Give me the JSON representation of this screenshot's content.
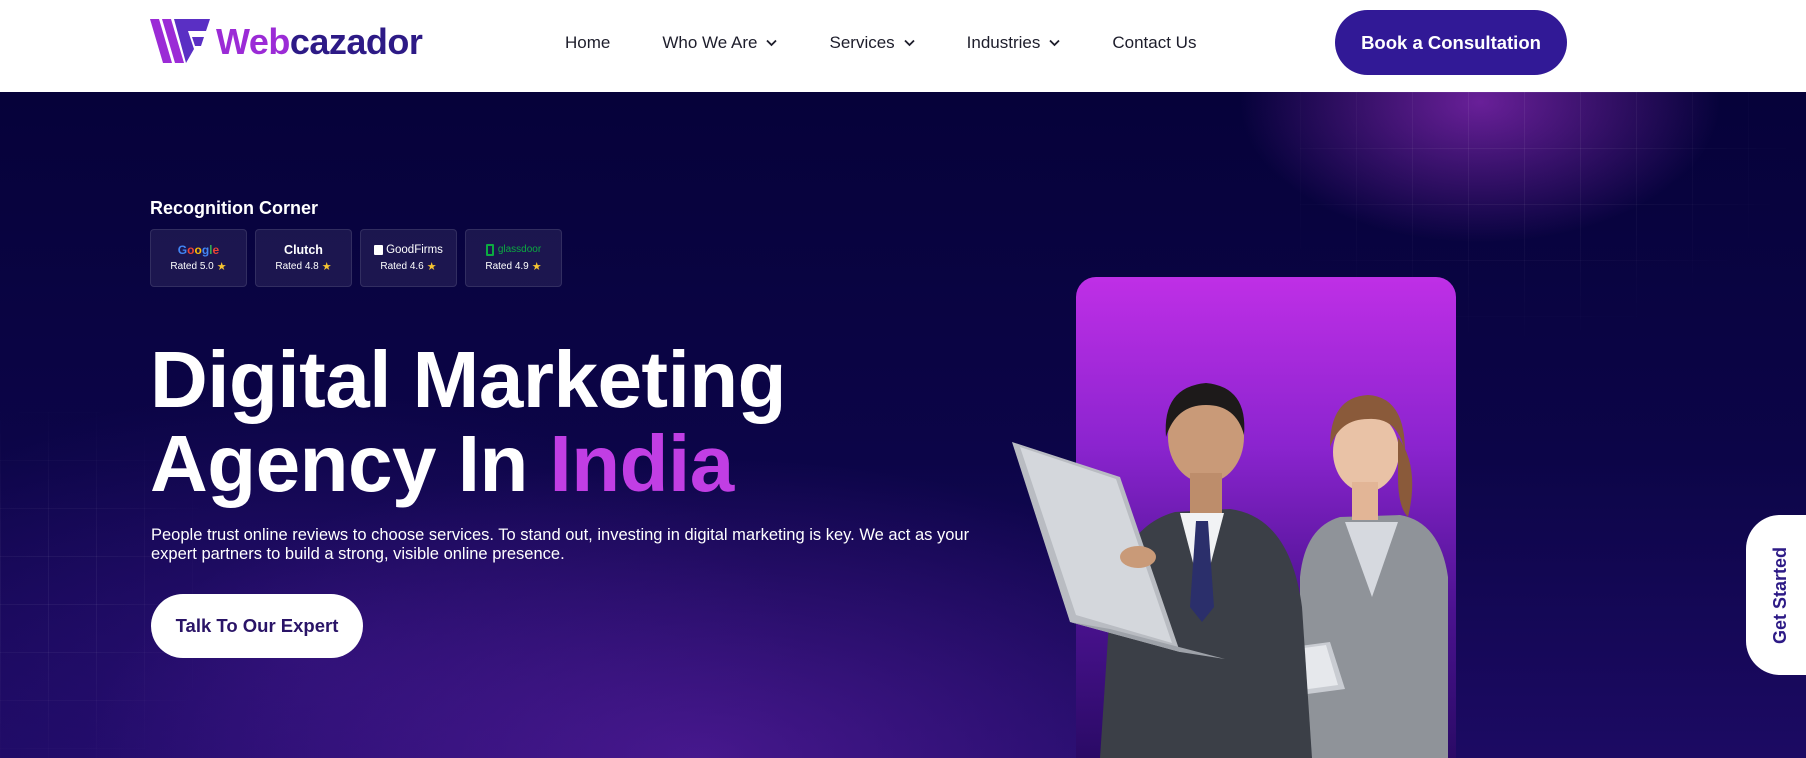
{
  "brand": {
    "logo_part1": "Web",
    "logo_part2": "cazador",
    "colors": {
      "primary": "#311996",
      "accent": "#c13ee4",
      "logo_purple": "#9b2bd6",
      "logo_navy": "#2d1a86"
    }
  },
  "nav": {
    "items": [
      {
        "label": "Home",
        "has_dropdown": false
      },
      {
        "label": "Who We Are",
        "has_dropdown": true
      },
      {
        "label": "Services",
        "has_dropdown": true
      },
      {
        "label": "Industries",
        "has_dropdown": true
      },
      {
        "label": "Contact Us",
        "has_dropdown": false
      }
    ],
    "cta": "Book a Consultation"
  },
  "hero": {
    "recognition_title": "Recognition Corner",
    "badges": [
      {
        "brand": "Google",
        "rating": "Rated 5.0",
        "icon": "star-icon"
      },
      {
        "brand": "Clutch",
        "rating": "Rated 4.8",
        "icon": "star-icon"
      },
      {
        "brand": "GoodFirms",
        "rating": "Rated 4.6",
        "icon": "star-icon"
      },
      {
        "brand": "glassdoor",
        "rating": "Rated 4.9",
        "icon": "star-icon"
      }
    ],
    "headline_line1": "Digital Marketing",
    "headline_line2": "Agency In ",
    "headline_accent": "India",
    "subtext": "People trust online reviews to choose services. To stand out, investing in digital marketing is key. We act as your expert partners to build a strong, visible online presence.",
    "cta": "Talk To Our Expert",
    "image": "business-team-with-laptop"
  },
  "side_tab": {
    "label": "Get Started"
  }
}
